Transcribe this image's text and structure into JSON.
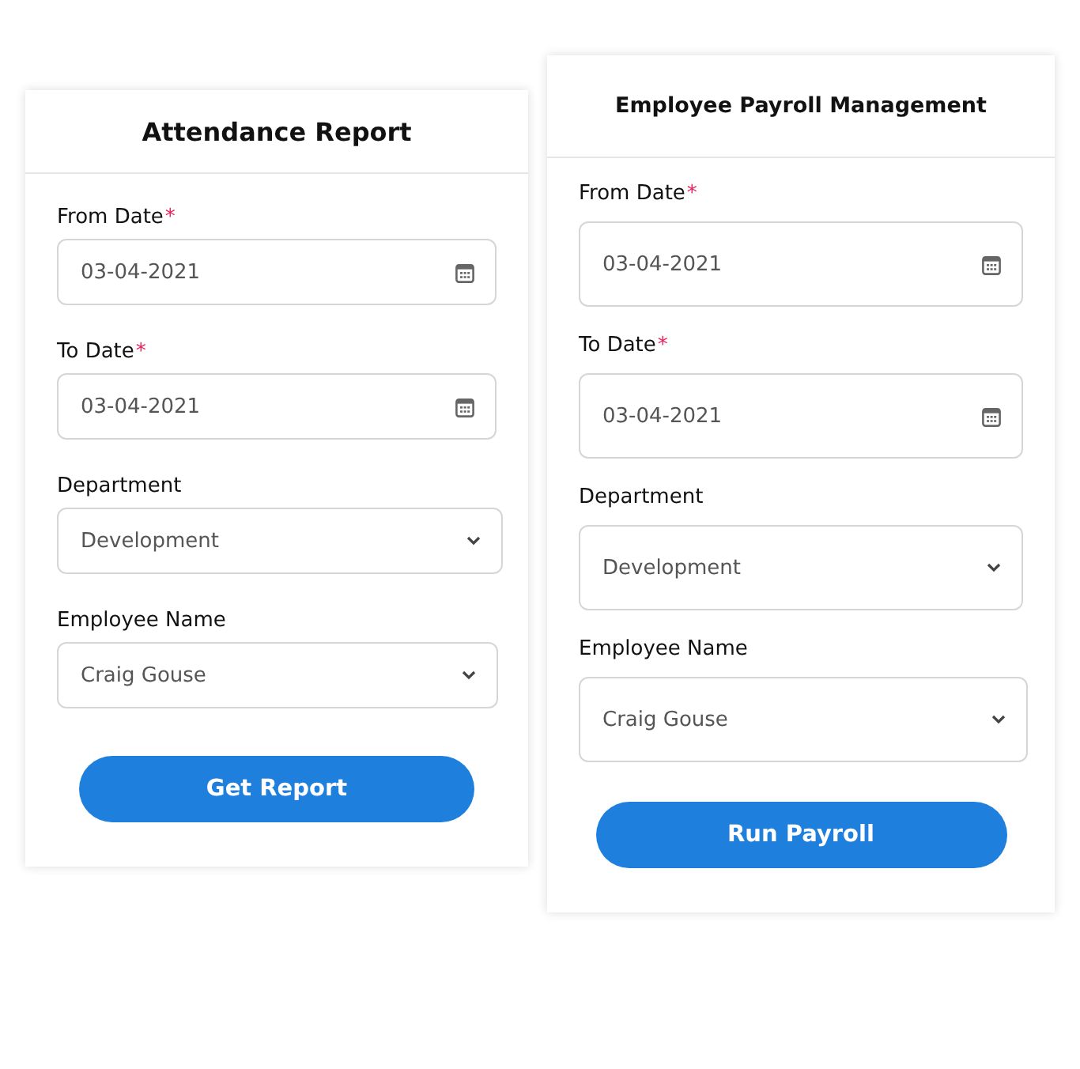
{
  "forms": [
    {
      "title": "Attendance Report",
      "fields": [
        {
          "label": "From Date",
          "mark": "*",
          "kind": "date",
          "value": "03-04-2021"
        },
        {
          "label": "To Date",
          "mark": "*",
          "kind": "date",
          "value": "03-04-2021"
        },
        {
          "label": "Department",
          "kind": "select",
          "value": "Development"
        },
        {
          "label": "Employee Name",
          "kind": "select",
          "value": "Craig Gouse"
        }
      ],
      "button": "Get Report"
    },
    {
      "title": "Employee Payroll Management",
      "fields": [
        {
          "label": "From Date",
          "mark": "*",
          "kind": "date",
          "value": "03-04-2021"
        },
        {
          "label": "To Date",
          "mark": "*",
          "kind": "date",
          "value": "03-04-2021"
        },
        {
          "label": "Department",
          "kind": "select",
          "value": "Development"
        },
        {
          "label": "Employee Name",
          "kind": "select",
          "value": "Craig Gouse"
        }
      ],
      "button": "Run Payroll"
    }
  ]
}
